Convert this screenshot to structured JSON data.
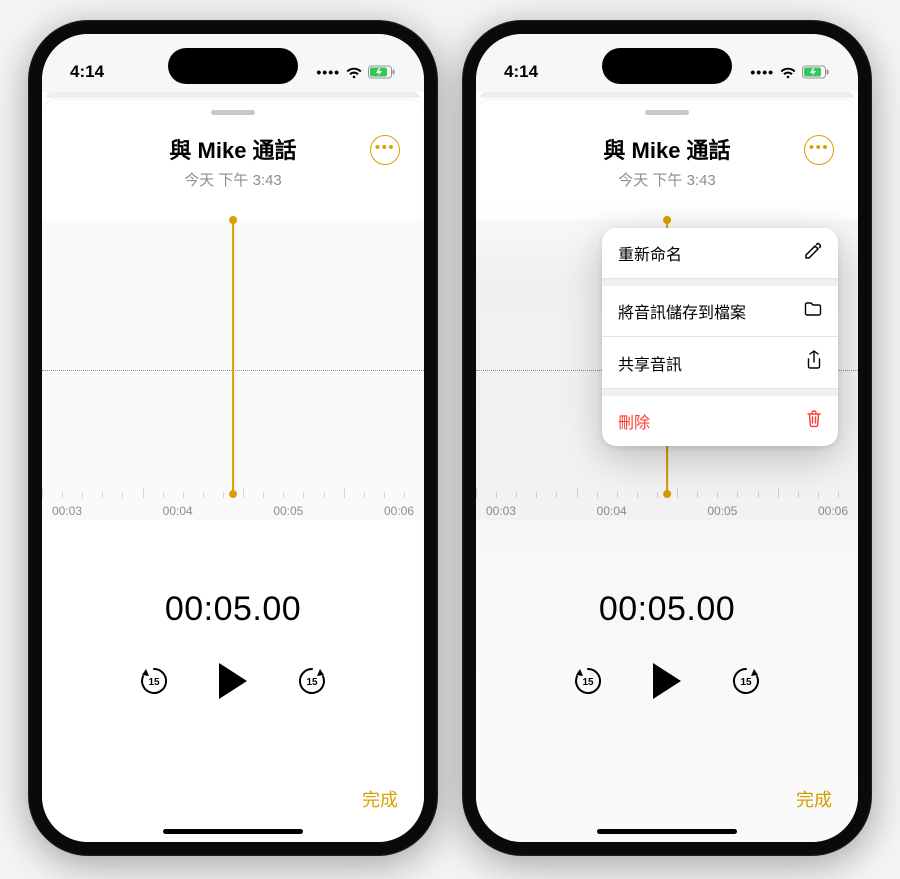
{
  "status": {
    "time": "4:14"
  },
  "recording": {
    "title": "與 Mike 通話",
    "subtitle": "今天 下午 3:43",
    "timecode": "00:05.00",
    "skip_seconds": "15",
    "done_label": "完成"
  },
  "ticks": [
    "00:03",
    "00:04",
    "00:05",
    "00:06"
  ],
  "menu": {
    "rename": "重新命名",
    "save_to_files": "將音訊儲存到檔案",
    "share_audio": "共享音訊",
    "delete": "刪除"
  }
}
